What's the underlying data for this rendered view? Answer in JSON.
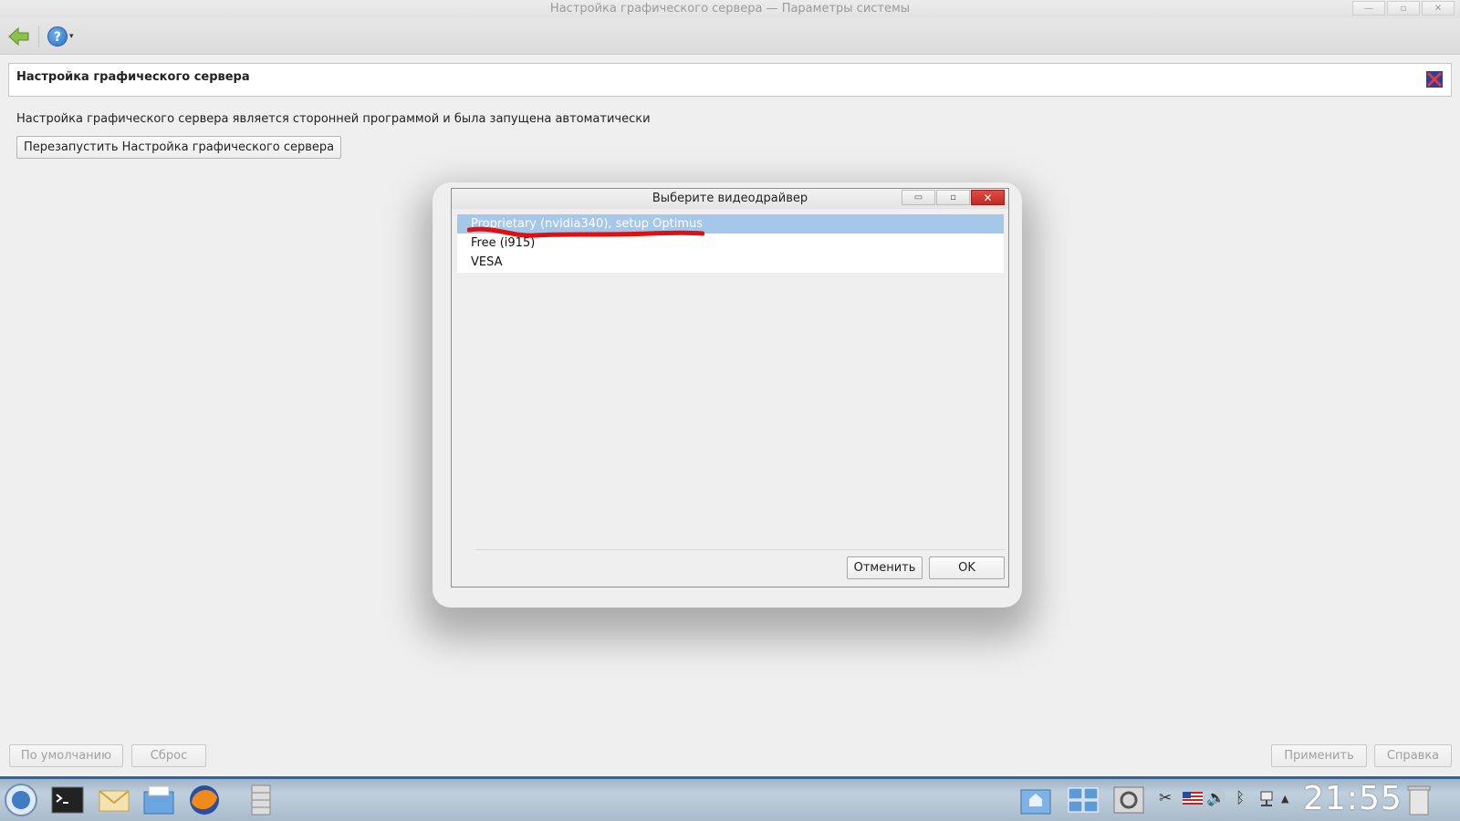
{
  "window": {
    "title": "Настройка графического сервера — Параметры системы",
    "minimize": "—",
    "maximize": "▫",
    "close": "✕"
  },
  "toolbar": {
    "back_icon": "back-arrow-icon",
    "help_symbol": "?",
    "help_caret": "▾"
  },
  "header": {
    "title": "Настройка графического сервера"
  },
  "main": {
    "info": "Настройка графического сервера является сторонней программой и была запущена автоматически",
    "restart_label": "Перезапустить Настройка графического сервера"
  },
  "dialog": {
    "title": "Выберите видеодрайвер",
    "minimize": "▭",
    "maximize": "▫",
    "close": "✕",
    "drivers": [
      "Proprietary (nvidia340), setup Optimus",
      "Free (i915)",
      "VESA"
    ],
    "selected_index": 0,
    "cancel_label": "Отменить",
    "ok_label": "OK"
  },
  "bottom": {
    "default_label": "По умолчанию",
    "reset_label": "Сброс",
    "apply_label": "Применить",
    "help_label": "Справка"
  },
  "taskbar": {
    "clock": "21:55",
    "colors": {
      "accent": "#2a63a8",
      "selection": "#a4c7ea",
      "annotation": "#e01010"
    }
  }
}
